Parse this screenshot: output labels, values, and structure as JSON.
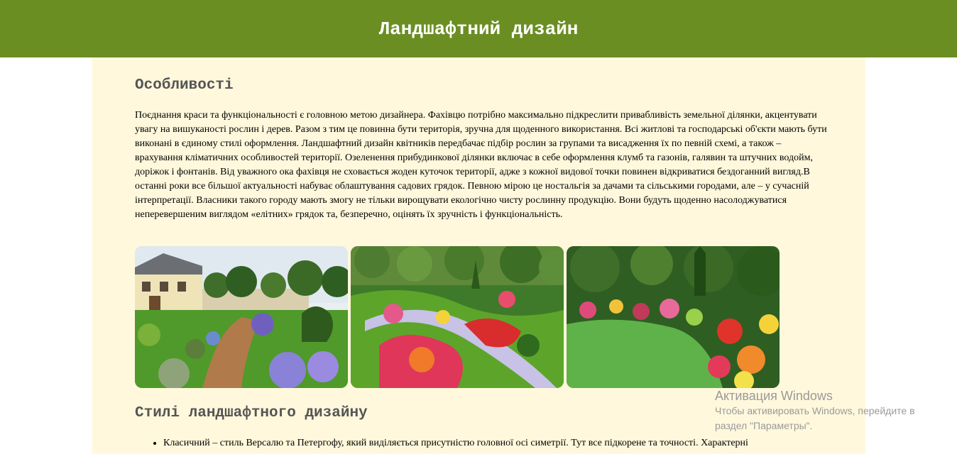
{
  "header": {
    "title": "Ландшафтний дизайн"
  },
  "section1": {
    "title": "Особливості",
    "paragraph": "Поєднання краси та функціональності є головною метою дизайнера. Фахівцю потрібно максимально підкреслити привабливість земельної ділянки, акцентувати увагу на вишуканості рослин і дерев. Разом з тим це повинна бути територія, зручна для щоденного використання. Всі житлові та господарські об'єкти мають бути виконані в єдиному стилі оформлення. Ландшафтний дизайн квітників передбачає підбір рослин за групами та висадження їх по певній схемі, а також – врахування кліматичних особливостей території. Озеленення прибудинкової ділянки включає в себе оформлення клумб та газонів, галявин та штучних водойм, доріжок і фонтанів. Від уважного ока фахівця не сховається жоден куточок території, адже з кожної видової точки повинен відкриватися бездоганний вигляд.В останні роки все більшої актуальності набуває облаштування садових грядок. Певною мірою це ностальгія за дачами та сільськими городами, але – у сучасній інтерпретації. Власники такого городу мають змогу не тільки вирощувати екологічно чисту рослинну продукцію. Вони будуть щоденно насолоджуватися неперевершеним виглядом «елітних» грядок та, безперечно, оцінять їх зручність і функціональність."
  },
  "gallery": {
    "images": [
      {
        "icon": "garden-house-photo"
      },
      {
        "icon": "flower-garden-photo"
      },
      {
        "icon": "lawn-flowerbed-photo"
      }
    ]
  },
  "section2": {
    "title": "Стилі ландшафтного дизайну",
    "items": [
      "Класичний – стиль Версалю та Петергофу, який виділяється присутністю головної осі симетрії. Тут все підкорене та точності. Характерні"
    ]
  },
  "watermark": {
    "title": "Активация Windows",
    "subtitle": "Чтобы активировать Windows, перейдите в раздел \"Параметры\"."
  },
  "colors": {
    "header_bg": "#6b8e23",
    "content_bg": "#fff8dc",
    "heading": "#555555"
  }
}
